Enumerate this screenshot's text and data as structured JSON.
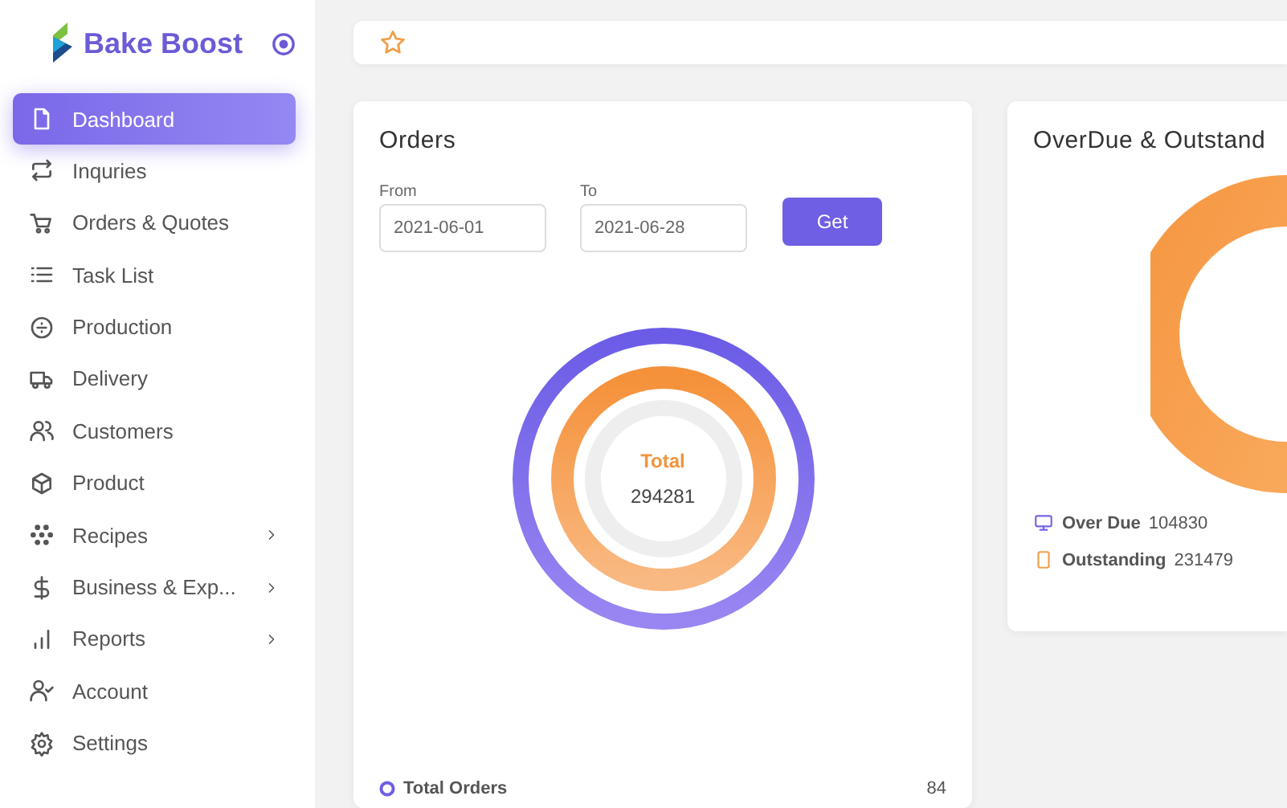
{
  "brand": {
    "name": "Bake Boost"
  },
  "sidebar": {
    "items": [
      {
        "label": "Dashboard",
        "selected": true,
        "expandable": false
      },
      {
        "label": "Inquries",
        "selected": false,
        "expandable": false
      },
      {
        "label": "Orders & Quotes",
        "selected": false,
        "expandable": false
      },
      {
        "label": "Task List",
        "selected": false,
        "expandable": false
      },
      {
        "label": "Production",
        "selected": false,
        "expandable": false
      },
      {
        "label": "Delivery",
        "selected": false,
        "expandable": false
      },
      {
        "label": "Customers",
        "selected": false,
        "expandable": false
      },
      {
        "label": "Product",
        "selected": false,
        "expandable": false
      },
      {
        "label": "Recipes",
        "selected": false,
        "expandable": true
      },
      {
        "label": "Business & Exp...",
        "selected": false,
        "expandable": true
      },
      {
        "label": "Reports",
        "selected": false,
        "expandable": true
      },
      {
        "label": "Account",
        "selected": false,
        "expandable": false
      },
      {
        "label": "Settings",
        "selected": false,
        "expandable": false
      }
    ]
  },
  "orders": {
    "title": "Orders",
    "from": {
      "label": "From",
      "value": "2021-06-01"
    },
    "to": {
      "label": "To",
      "value": "2021-06-28"
    },
    "button": "Get",
    "center_label": "Total",
    "center_value": "294281",
    "legend": {
      "label": "Total Orders",
      "value": "84"
    }
  },
  "overdue": {
    "title": "OverDue & Outstand",
    "legend": [
      {
        "label": "Over Due",
        "value": "104830",
        "color": "#7466e8"
      },
      {
        "label": "Outstanding",
        "value": "231479",
        "color": "#f0a04a"
      }
    ]
  }
}
